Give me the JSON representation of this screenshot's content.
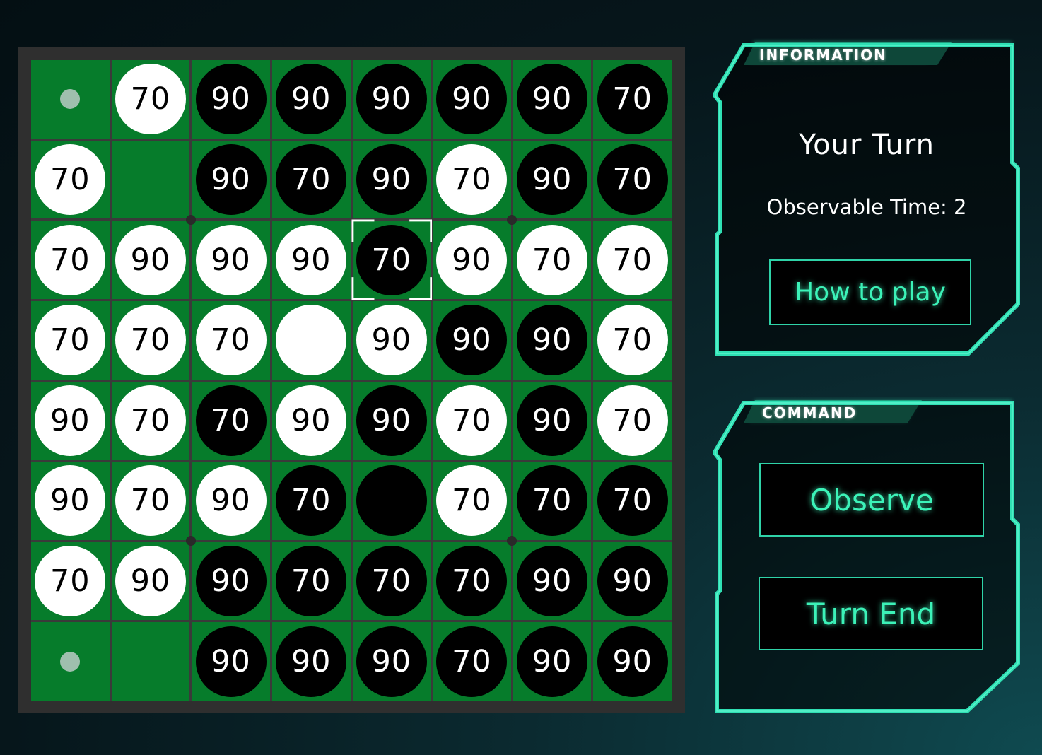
{
  "board": {
    "rows": [
      [
        {
          "t": "hint"
        },
        {
          "t": "w",
          "v": "70"
        },
        {
          "t": "b",
          "v": "90"
        },
        {
          "t": "b",
          "v": "90"
        },
        {
          "t": "b",
          "v": "90"
        },
        {
          "t": "b",
          "v": "90"
        },
        {
          "t": "b",
          "v": "90"
        },
        {
          "t": "b",
          "v": "70"
        }
      ],
      [
        {
          "t": "w",
          "v": "70"
        },
        {
          "t": "empty"
        },
        {
          "t": "b",
          "v": "90"
        },
        {
          "t": "b",
          "v": "70"
        },
        {
          "t": "b",
          "v": "90"
        },
        {
          "t": "w",
          "v": "70"
        },
        {
          "t": "b",
          "v": "90"
        },
        {
          "t": "b",
          "v": "70"
        }
      ],
      [
        {
          "t": "w",
          "v": "70"
        },
        {
          "t": "w",
          "v": "90"
        },
        {
          "t": "w",
          "v": "90"
        },
        {
          "t": "w",
          "v": "90"
        },
        {
          "t": "b",
          "v": "70",
          "selected": true
        },
        {
          "t": "w",
          "v": "90"
        },
        {
          "t": "w",
          "v": "70"
        },
        {
          "t": "w",
          "v": "70"
        }
      ],
      [
        {
          "t": "w",
          "v": "70"
        },
        {
          "t": "w",
          "v": "70"
        },
        {
          "t": "w",
          "v": "70"
        },
        {
          "t": "w",
          "v": ""
        },
        {
          "t": "w",
          "v": "90"
        },
        {
          "t": "b",
          "v": "90"
        },
        {
          "t": "b",
          "v": "90"
        },
        {
          "t": "w",
          "v": "70"
        }
      ],
      [
        {
          "t": "w",
          "v": "90"
        },
        {
          "t": "w",
          "v": "70"
        },
        {
          "t": "b",
          "v": "70"
        },
        {
          "t": "w",
          "v": "90"
        },
        {
          "t": "b",
          "v": "90"
        },
        {
          "t": "w",
          "v": "70"
        },
        {
          "t": "b",
          "v": "90"
        },
        {
          "t": "w",
          "v": "70"
        }
      ],
      [
        {
          "t": "w",
          "v": "90"
        },
        {
          "t": "w",
          "v": "70"
        },
        {
          "t": "w",
          "v": "90"
        },
        {
          "t": "b",
          "v": "70"
        },
        {
          "t": "b",
          "v": ""
        },
        {
          "t": "w",
          "v": "70"
        },
        {
          "t": "b",
          "v": "70"
        },
        {
          "t": "b",
          "v": "70"
        }
      ],
      [
        {
          "t": "w",
          "v": "70"
        },
        {
          "t": "w",
          "v": "90"
        },
        {
          "t": "b",
          "v": "90"
        },
        {
          "t": "b",
          "v": "70"
        },
        {
          "t": "b",
          "v": "70"
        },
        {
          "t": "b",
          "v": "70"
        },
        {
          "t": "b",
          "v": "90"
        },
        {
          "t": "b",
          "v": "90"
        }
      ],
      [
        {
          "t": "hint"
        },
        {
          "t": "empty"
        },
        {
          "t": "b",
          "v": "90"
        },
        {
          "t": "b",
          "v": "90"
        },
        {
          "t": "b",
          "v": "90"
        },
        {
          "t": "b",
          "v": "70"
        },
        {
          "t": "b",
          "v": "90"
        },
        {
          "t": "b",
          "v": "90"
        }
      ]
    ]
  },
  "info_panel": {
    "tab_label": "INFORMATION",
    "turn_text": "Your Turn",
    "observable_text": "Observable Time: 2",
    "how_to_play_label": "How to play"
  },
  "command_panel": {
    "tab_label": "COMMAND",
    "observe_label": "Observe",
    "turn_end_label": "Turn End"
  },
  "colors": {
    "board_green": "#067c2b",
    "neon_accent": "#2fd3a8",
    "neon_text": "#3cf2b8",
    "white_disc": "#ffffff",
    "black_disc": "#000000"
  }
}
